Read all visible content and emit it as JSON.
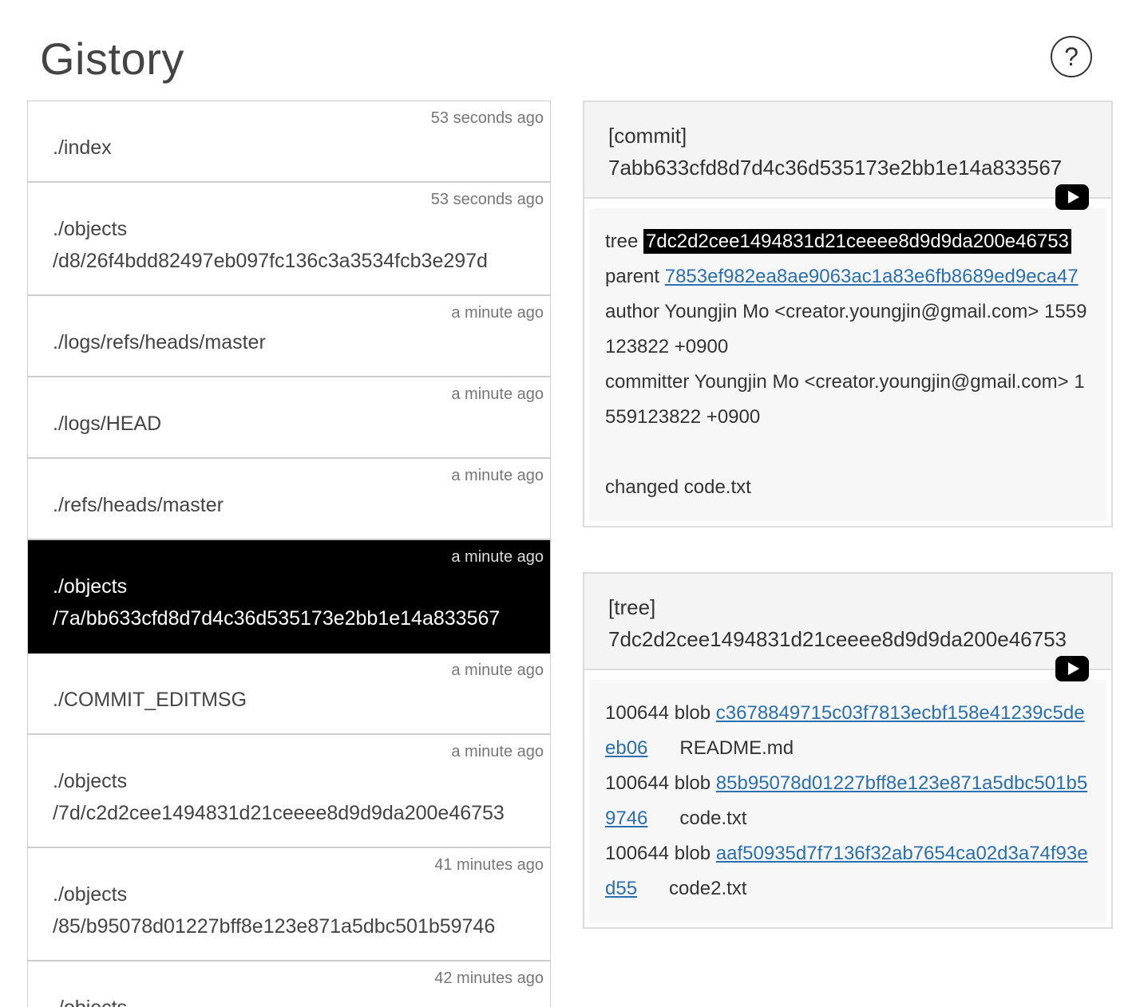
{
  "app": {
    "title": "Gistory",
    "help_label": "?"
  },
  "files": [
    {
      "time": "53 seconds ago",
      "path": "./index"
    },
    {
      "time": "53 seconds ago",
      "path": "./objects\n/d8/26f4bdd82497eb097fc136c3a3534fcb3e297d"
    },
    {
      "time": "a minute ago",
      "path": "./logs/refs/heads/master"
    },
    {
      "time": "a minute ago",
      "path": "./logs/HEAD"
    },
    {
      "time": "a minute ago",
      "path": "./refs/heads/master"
    },
    {
      "time": "a minute ago",
      "path": "./objects\n/7a/bb633cfd8d7d4c36d535173e2bb1e14a833567"
    },
    {
      "time": "a minute ago",
      "path": "./COMMIT_EDITMSG"
    },
    {
      "time": "a minute ago",
      "path": "./objects\n/7d/c2d2cee1494831d21ceeee8d9d9da200e46753"
    },
    {
      "time": "41 minutes ago",
      "path": "./objects\n/85/b95078d01227bff8e123e871a5dbc501b59746"
    },
    {
      "time": "42 minutes ago",
      "path": "./objects"
    }
  ],
  "commit_panel": {
    "type_label": "[commit]",
    "hash": "7abb633cfd8d7d4c36d535173e2bb1e14a833567",
    "tree_label": "tree",
    "tree_hash": "7dc2d2cee1494831d21ceeee8d9d9da200e46753",
    "parent_label": "parent",
    "parent_hash": "7853ef982ea8ae9063ac1a83e6fb8689ed9eca47",
    "author_line": "author Youngjin Mo <creator.youngjin@gmail.com> 1559123822 +0900",
    "committer_line": "committer Youngjin Mo <creator.youngjin@gmail.com> 1559123822 +0900",
    "message": "changed code.txt"
  },
  "tree_panel": {
    "type_label": "[tree]",
    "hash": "7dc2d2cee1494831d21ceeee8d9d9da200e46753",
    "entries": [
      {
        "prefix": "100644 blob ",
        "hash": "c3678849715c03f7813ecbf158e41239c5deeb06",
        "name": "README.md"
      },
      {
        "prefix": "100644 blob ",
        "hash": "85b95078d01227bff8e123e871a5dbc501b59746",
        "name": "code.txt"
      },
      {
        "prefix": "100644 blob ",
        "hash": "aaf50935d7f7136f32ab7654ca02d3a74f93ed55",
        "name": "code2.txt"
      }
    ]
  }
}
